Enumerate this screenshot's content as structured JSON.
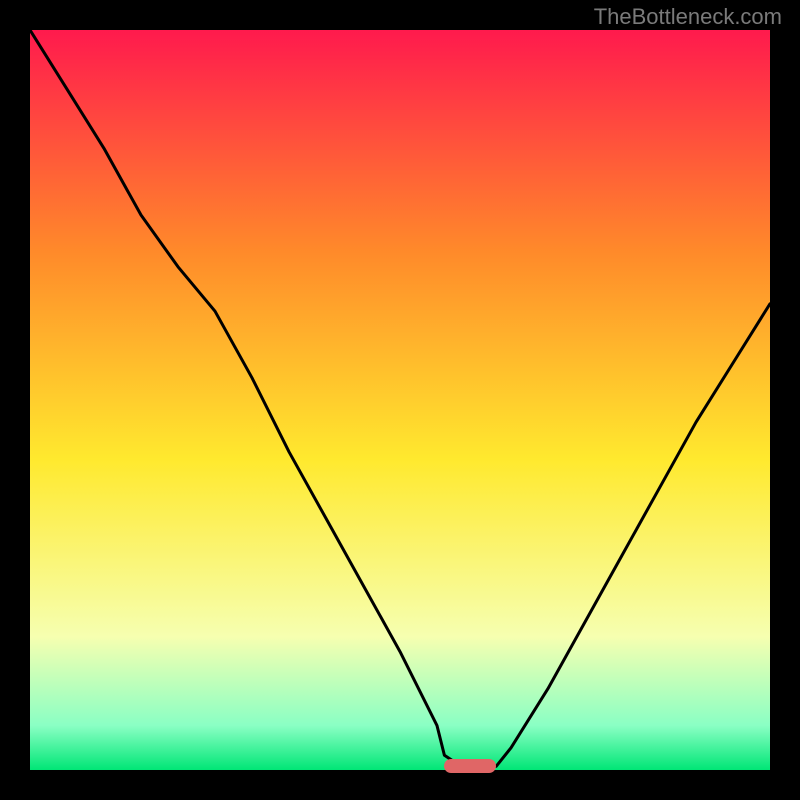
{
  "watermark": "TheBottleneck.com",
  "chart_data": {
    "type": "line",
    "title": "",
    "xlabel": "",
    "ylabel": "",
    "xlim": [
      0,
      100
    ],
    "ylim": [
      0,
      100
    ],
    "grid": false,
    "legend": false,
    "background_gradient": {
      "top": "#ff1a4d",
      "upper_mid": "#ff8a2a",
      "mid": "#ffe92e",
      "lower_mid": "#f6ffb0",
      "near_bottom": "#8affc4",
      "bottom": "#00e676"
    },
    "series": [
      {
        "name": "bottleneck-curve",
        "color": "#000000",
        "x": [
          0,
          5,
          10,
          15,
          20,
          25,
          30,
          35,
          40,
          45,
          50,
          55,
          56,
          59,
          61,
          63,
          65,
          70,
          75,
          80,
          85,
          90,
          95,
          100
        ],
        "y": [
          100,
          92,
          84,
          75,
          68,
          62,
          53,
          43,
          34,
          25,
          16,
          6,
          2,
          0,
          0,
          0.5,
          3,
          11,
          20,
          29,
          38,
          47,
          55,
          63
        ]
      }
    ],
    "marker": {
      "name": "optimal-range",
      "x_start": 56,
      "x_end": 63,
      "y": 0,
      "color": "#e06666"
    }
  }
}
